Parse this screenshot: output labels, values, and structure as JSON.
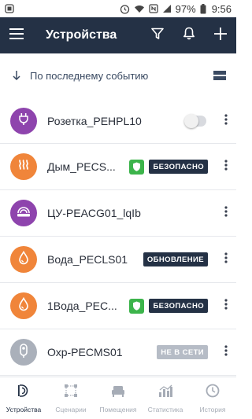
{
  "status_bar": {
    "battery": "97%",
    "time": "9:56",
    "icons": [
      "notification-icon",
      "alarm-icon",
      "wifi-icon",
      "nfc-icon",
      "signal-icon",
      "battery-icon"
    ]
  },
  "header": {
    "title": "Устройства",
    "icons": [
      "menu-icon",
      "filter-icon",
      "bell-icon",
      "plus-icon"
    ]
  },
  "sort": {
    "label": "По последнему событию",
    "icons": [
      "arrow-down-icon",
      "list-view-icon"
    ]
  },
  "devices": [
    {
      "name": "Розетка_PEHPL10",
      "icon": "socket-icon",
      "icon_color": "#8e44ad",
      "control": "toggle",
      "toggle_on": false
    },
    {
      "name": "Дым_PECS...",
      "icon": "smoke-icon",
      "icon_color": "#f0853a",
      "shield": true,
      "badge": "БЕЗОПАСНО"
    },
    {
      "name": "ЦУ-PEACG01_lqIb",
      "icon": "hub-icon",
      "icon_color": "#8e44ad"
    },
    {
      "name": "Вода_PECLS01",
      "icon": "water-drop-icon",
      "icon_color": "#f0853a",
      "badge": "ОБНОВЛЕНИЕ"
    },
    {
      "name": "1Вода_PEC...",
      "icon": "water-drop-icon",
      "icon_color": "#f0853a",
      "shield": true,
      "badge": "БЕЗОПАСНО"
    },
    {
      "name": "Охр-PECMS01",
      "icon": "motion-sensor-icon",
      "icon_color": "#aab0ba",
      "badge": "НЕ В СЕТИ",
      "badge_style": "offline"
    }
  ],
  "bottom_nav": [
    {
      "label": "Устройства",
      "icon": "devices-icon",
      "active": true
    },
    {
      "label": "Сценарии",
      "icon": "scenarios-icon",
      "active": false
    },
    {
      "label": "Помещения",
      "icon": "rooms-icon",
      "active": false
    },
    {
      "label": "Статистика",
      "icon": "statistics-icon",
      "active": false
    },
    {
      "label": "История",
      "icon": "history-icon",
      "active": false
    }
  ],
  "colors": {
    "header_bg": "#243145",
    "accent_purple": "#8e44ad",
    "accent_orange": "#f0853a",
    "safe_green": "#3cb44b",
    "offline_gray": "#b6bcc6"
  }
}
